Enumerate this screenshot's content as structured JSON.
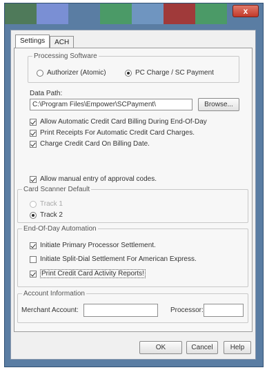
{
  "window": {
    "close_glyph": "x",
    "title_colors": [
      "#4f7a5a",
      "#7a8fd4",
      "#5a7da3",
      "#4b9a67",
      "#6f95c0",
      "#a03a3a",
      "#4b9a67",
      "#5a7da3"
    ]
  },
  "tabs": [
    {
      "label": "Settings",
      "active": true
    },
    {
      "label": "ACH",
      "active": false
    }
  ],
  "processing_software": {
    "legend": "Processing Software",
    "options": [
      {
        "label": "Authorizer (Atomic)",
        "selected": false
      },
      {
        "label": "PC Charge / SC Payment",
        "selected": true
      }
    ]
  },
  "data_path": {
    "label": "Data Path:",
    "value": "C:\\Program Files\\Empower\\SCPayment\\",
    "browse_label": "Browse..."
  },
  "options": [
    {
      "label": "Allow Automatic Credit Card Billing During End-Of-Day",
      "checked": true
    },
    {
      "label": "Print Receipts For Automatic Credit Card Charges.",
      "checked": true
    },
    {
      "label": "Charge Credit Card On Billing Date.",
      "checked": true
    }
  ],
  "manual_entry": {
    "label": "Allow manual entry of approval codes.",
    "checked": true
  },
  "card_scanner": {
    "legend": "Card Scanner Default",
    "options": [
      {
        "label": "Track 1",
        "selected": false,
        "disabled": true
      },
      {
        "label": "Track 2",
        "selected": true,
        "disabled": false
      }
    ]
  },
  "eod": {
    "legend": "End-Of-Day Automation",
    "options": [
      {
        "label": "Initiate Primary Processor Settlement.",
        "checked": true
      },
      {
        "label": "Initiate Split-Dial Settlement For American Express.",
        "checked": false
      },
      {
        "label": "Print Credit Card Activity Reports!",
        "checked": true
      }
    ]
  },
  "account": {
    "legend": "Account Information",
    "merchant_label": "Merchant Account:",
    "merchant_value": "",
    "processor_label": "Processor:",
    "processor_value": ""
  },
  "footer": {
    "ok": "OK",
    "cancel": "Cancel",
    "help": "Help"
  }
}
